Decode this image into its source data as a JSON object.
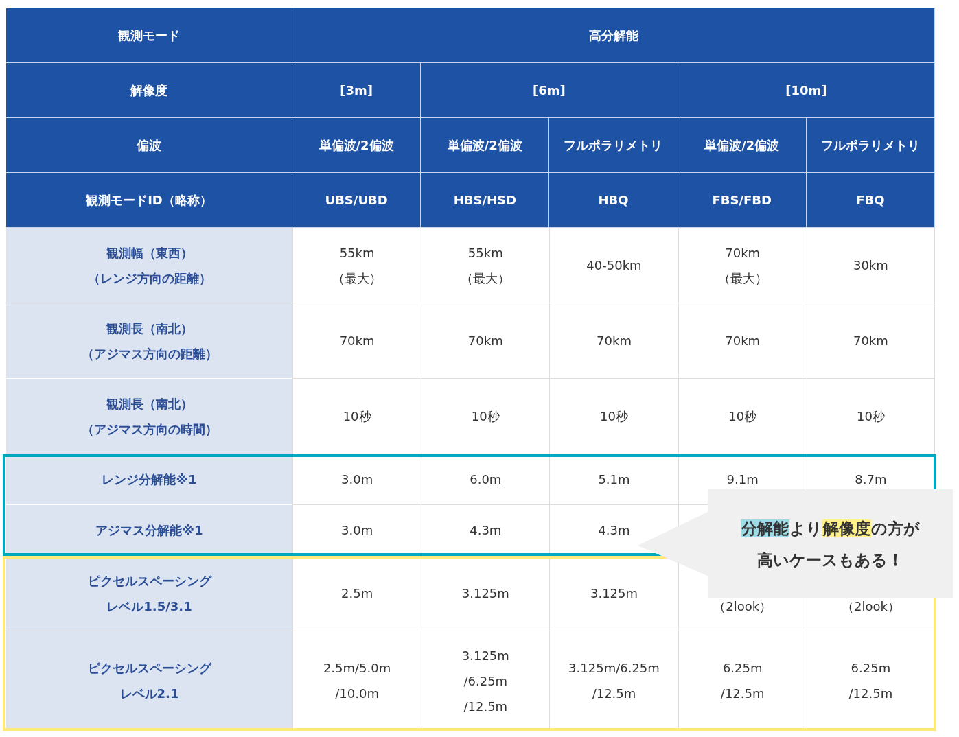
{
  "header_rows": [
    [
      {
        "text": "観測モード"
      },
      {
        "text": "高分解能"
      }
    ],
    [
      {
        "text": "解像度"
      },
      {
        "text": "[3m]"
      },
      {
        "text": "[6m]"
      },
      {
        "text": "[10m]"
      }
    ],
    [
      {
        "text": "偏波"
      },
      {
        "text": "単偏波/2偏波"
      },
      {
        "text": "単偏波/2偏波"
      },
      {
        "text": "フルポラリメトリ"
      },
      {
        "text": "単偏波/2偏波"
      },
      {
        "text": "フルポラリメトリ"
      }
    ],
    [
      {
        "text": "観測モードID（略称）"
      },
      {
        "text": "UBS/UBD"
      },
      {
        "text": "HBS/HSD"
      },
      {
        "text": "HBQ"
      },
      {
        "text": "FBS/FBD"
      },
      {
        "text": "FBQ"
      }
    ]
  ],
  "body_groups": [
    {
      "rows": [
        {
          "label": [
            "観測幅（東西）",
            "（レンジ方向の距離）"
          ],
          "cells": [
            {
              "lines": [
                "55km",
                "（最大）"
              ]
            },
            {
              "lines": [
                "55km",
                "（最大）"
              ]
            },
            {
              "lines": [
                "40-50km"
              ]
            },
            {
              "lines": [
                "70km",
                "（最大）"
              ]
            },
            {
              "lines": [
                "30km"
              ]
            }
          ]
        },
        {
          "label": [
            "観測長（南北）",
            "（アジマス方向の距離）"
          ],
          "cells": [
            {
              "lines": [
                "70km"
              ]
            },
            {
              "lines": [
                "70km"
              ]
            },
            {
              "lines": [
                "70km"
              ]
            },
            {
              "lines": [
                "70km"
              ]
            },
            {
              "lines": [
                "70km"
              ]
            }
          ]
        },
        {
          "label": [
            "観測長（南北）",
            "（アジマス方向の時間）"
          ],
          "cells": [
            {
              "lines": [
                "10秒"
              ]
            },
            {
              "lines": [
                "10秒"
              ]
            },
            {
              "lines": [
                "10秒"
              ]
            },
            {
              "lines": [
                "10秒"
              ]
            },
            {
              "lines": [
                "10秒"
              ]
            }
          ]
        }
      ]
    },
    {
      "color": "#00a8c0",
      "rows": [
        {
          "label": [
            "レンジ分解能※1"
          ],
          "cells": [
            {
              "lines": [
                "3.0m"
              ]
            },
            {
              "lines": [
                "6.0m"
              ]
            },
            {
              "lines": [
                "5.1m"
              ]
            },
            {
              "lines": [
                "9.1m"
              ]
            },
            {
              "lines": [
                "8.7m"
              ]
            }
          ]
        },
        {
          "label": [
            "アジマス分解能※1"
          ],
          "cells": [
            {
              "lines": [
                "3.0m"
              ]
            },
            {
              "lines": [
                "4.3m"
              ]
            },
            {
              "lines": [
                "4.3m"
              ]
            }
          ]
        }
      ]
    },
    {
      "color": "#ffe97a",
      "rows": [
        {
          "label": [
            "ピクセルスペーシング",
            "レベル1.5/3.1"
          ],
          "cells": [
            {
              "lines": [
                "2.5m"
              ]
            },
            {
              "lines": [
                "3.125m"
              ]
            },
            {
              "lines": [
                "3.125m"
              ]
            },
            {
              "lines": [
                "（2look）"
              ],
              "top_covered": true
            },
            {
              "lines": [
                "（2look）"
              ],
              "top_covered": true
            }
          ]
        },
        {
          "label": [
            "ピクセルスペーシング",
            "レベル2.1"
          ],
          "cells": [
            {
              "lines": [
                "2.5m/5.0m",
                "/10.0m"
              ]
            },
            {
              "lines": [
                "3.125m",
                "/6.25m",
                "/12.5m"
              ]
            },
            {
              "lines": [
                "3.125m/6.25m",
                "/12.5m"
              ]
            },
            {
              "lines": [
                "6.25m",
                "/12.5m"
              ]
            },
            {
              "lines": [
                "6.25m",
                "/12.5m"
              ]
            }
          ]
        }
      ]
    }
  ],
  "callout": {
    "lines": [
      [
        {
          "text": "分解能",
          "color": "#9ddbe6"
        },
        {
          "text": "より"
        },
        {
          "text": "解像度",
          "color": "#fff08a"
        },
        {
          "text": "の方が"
        }
      ],
      [
        {
          "text": "高いケースもある！"
        }
      ]
    ]
  }
}
